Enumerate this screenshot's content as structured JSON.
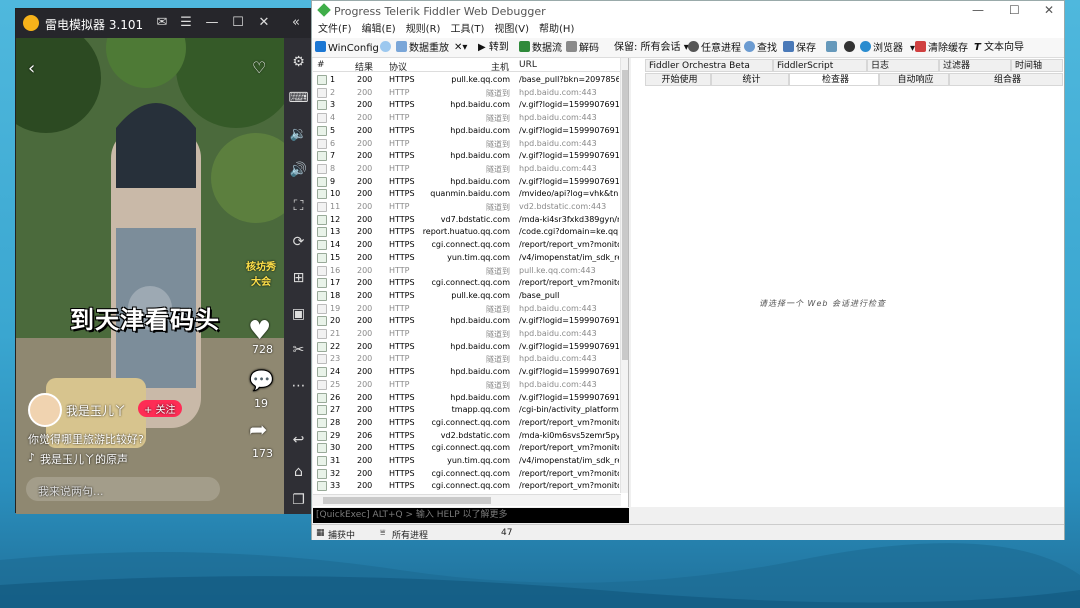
{
  "emulator": {
    "title": "雷电模拟器 3.101",
    "video": {
      "caption": "到天津看码头",
      "badge": "核坊秀大会",
      "user": "我是玉儿丫",
      "follow": "+ 关注",
      "question": "你觉得哪里旅游比较好?",
      "music": "我是玉儿丫的原声",
      "comment_placeholder": "我来说两句...",
      "likes": "728",
      "comments": "19",
      "shares": "173"
    }
  },
  "fiddler": {
    "title": "Progress Telerik Fiddler Web Debugger",
    "menu": [
      "文件(F)",
      "编辑(E)",
      "规则(R)",
      "工具(T)",
      "视图(V)",
      "帮助(H)"
    ],
    "toolbar": {
      "winconfig": "WinConfig",
      "replay": "数据重放",
      "goto": "转到",
      "stream": "数据流",
      "decode": "解码",
      "keep": "保留: 所有会话",
      "any_process": "任意进程",
      "find": "查找",
      "save": "保存",
      "browse": "浏览器",
      "clear_cache": "清除缓存",
      "text_wizard": "文本向导"
    },
    "tabs_top": [
      "Fiddler Orchestra Beta",
      "FiddlerScript",
      "日志",
      "过滤器",
      "时间轴"
    ],
    "tabs_bottom": [
      "开始使用",
      "统计",
      "检查器",
      "自动响应",
      "组合器"
    ],
    "selected_tab": "检查器",
    "hint": "请选择一个 Web 会话进行检查",
    "columns": [
      "#",
      "结果",
      "协议",
      "主机",
      "URL"
    ],
    "sessions": [
      [
        "1",
        "200",
        "HTTPS",
        "pull.ke.qq.com",
        "/base_pull?bkn=2097856..."
      ],
      [
        "2",
        "200",
        "HTTP",
        "隧道到",
        "hpd.baidu.com:443"
      ],
      [
        "3",
        "200",
        "HTTPS",
        "hpd.baidu.com",
        "/v.gif?logid=1599907691..."
      ],
      [
        "4",
        "200",
        "HTTP",
        "隧道到",
        "hpd.baidu.com:443"
      ],
      [
        "5",
        "200",
        "HTTPS",
        "hpd.baidu.com",
        "/v.gif?logid=1599907691..."
      ],
      [
        "6",
        "200",
        "HTTP",
        "隧道到",
        "hpd.baidu.com:443"
      ],
      [
        "7",
        "200",
        "HTTPS",
        "hpd.baidu.com",
        "/v.gif?logid=1599907691..."
      ],
      [
        "8",
        "200",
        "HTTP",
        "隧道到",
        "hpd.baidu.com:443"
      ],
      [
        "9",
        "200",
        "HTTPS",
        "hpd.baidu.com",
        "/v.gif?logid=1599907691..."
      ],
      [
        "10",
        "200",
        "HTTPS",
        "quanmin.baidu.com",
        "/mvideo/api?log=vhk&tn=..."
      ],
      [
        "11",
        "200",
        "HTTP",
        "隧道到",
        "vd2.bdstatic.com:443"
      ],
      [
        "12",
        "200",
        "HTTPS",
        "vd7.bdstatic.com",
        "/mda-ki4sr3fxkd389gyn/m..."
      ],
      [
        "13",
        "200",
        "HTTPS",
        "report.huatuo.qq.com",
        "/code.cgi?domain=ke.qq..."
      ],
      [
        "14",
        "200",
        "HTTPS",
        "cgi.connect.qq.com",
        "/report/report_vm?monito..."
      ],
      [
        "15",
        "200",
        "HTTPS",
        "yun.tim.qq.com",
        "/v4/imopenstat/im_sdk_re..."
      ],
      [
        "16",
        "200",
        "HTTP",
        "隧道到",
        "pull.ke.qq.com:443"
      ],
      [
        "17",
        "200",
        "HTTPS",
        "cgi.connect.qq.com",
        "/report/report_vm?monito..."
      ],
      [
        "18",
        "200",
        "HTTPS",
        "pull.ke.qq.com",
        "/base_pull"
      ],
      [
        "19",
        "200",
        "HTTP",
        "隧道到",
        "hpd.baidu.com:443"
      ],
      [
        "20",
        "200",
        "HTTPS",
        "hpd.baidu.com",
        "/v.gif?logid=1599907691..."
      ],
      [
        "21",
        "200",
        "HTTP",
        "隧道到",
        "hpd.baidu.com:443"
      ],
      [
        "22",
        "200",
        "HTTPS",
        "hpd.baidu.com",
        "/v.gif?logid=1599907691..."
      ],
      [
        "23",
        "200",
        "HTTP",
        "隧道到",
        "hpd.baidu.com:443"
      ],
      [
        "24",
        "200",
        "HTTPS",
        "hpd.baidu.com",
        "/v.gif?logid=1599907691..."
      ],
      [
        "25",
        "200",
        "HTTP",
        "隧道到",
        "hpd.baidu.com:443"
      ],
      [
        "26",
        "200",
        "HTTPS",
        "hpd.baidu.com",
        "/v.gif?logid=1599907691..."
      ],
      [
        "27",
        "200",
        "HTTPS",
        "tmapp.qq.com",
        "/cgi-bin/activity_platform/..."
      ],
      [
        "28",
        "200",
        "HTTPS",
        "cgi.connect.qq.com",
        "/report/report_vm?monito..."
      ],
      [
        "29",
        "206",
        "HTTPS",
        "vd2.bdstatic.com",
        "/mda-ki0m6svs5zemr5py/..."
      ],
      [
        "30",
        "200",
        "HTTPS",
        "cgi.connect.qq.com",
        "/report/report_vm?monito..."
      ],
      [
        "31",
        "200",
        "HTTPS",
        "yun.tim.qq.com",
        "/v4/imopenstat/im_sdk_re..."
      ],
      [
        "32",
        "200",
        "HTTPS",
        "cgi.connect.qq.com",
        "/report/report_vm?monito..."
      ],
      [
        "33",
        "200",
        "HTTPS",
        "cgi.connect.qq.com",
        "/report/report_vm?monito..."
      ]
    ],
    "quickexec": "[QuickExec] ALT+Q > 输入 HELP 以了解更多",
    "status": {
      "capturing": "捕获中",
      "processes": "所有进程",
      "count": "47"
    },
    "colors": {
      "tunnel": "#8a8a8a",
      "https_row": "#000000",
      "http_tunnel_row": "#8a8a8a"
    }
  }
}
